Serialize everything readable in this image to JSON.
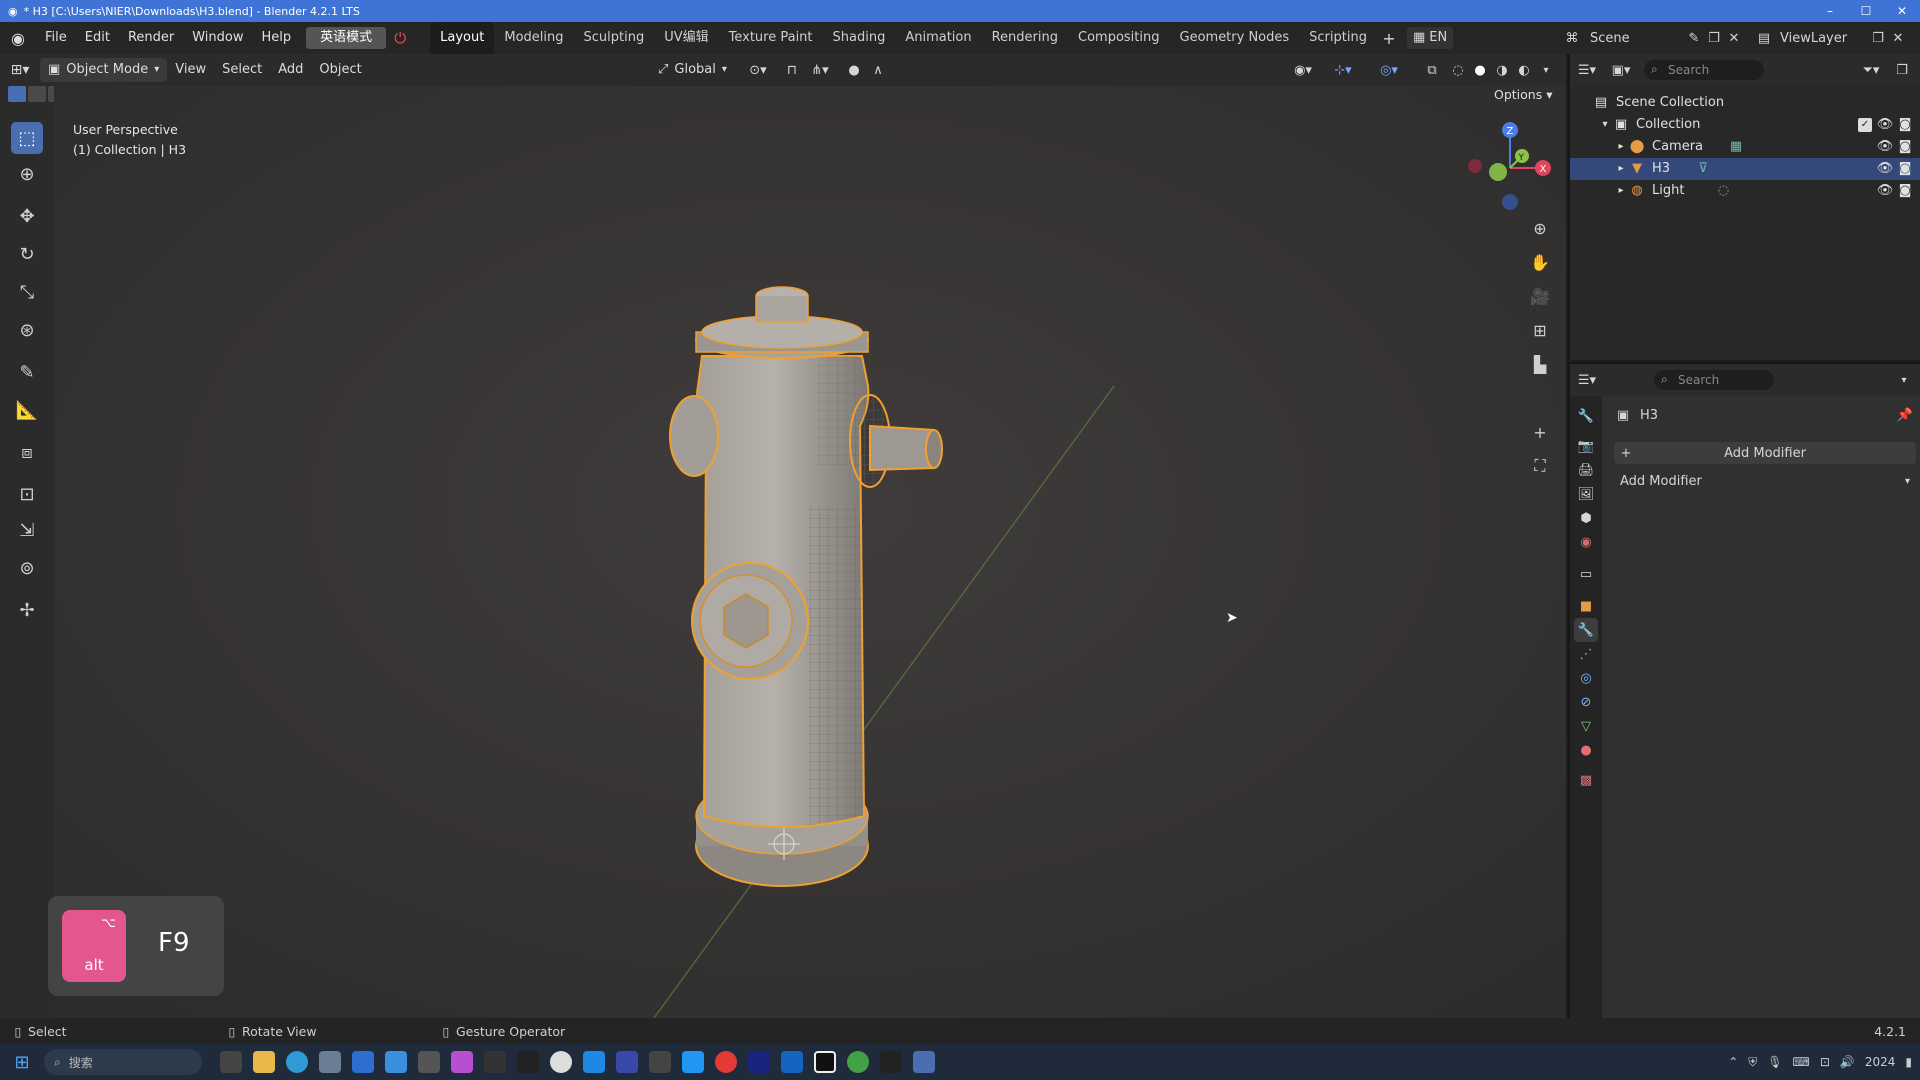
{
  "titlebar": {
    "title": "* H3 [C:\\Users\\NIER\\Downloads\\H3.blend] - Blender 4.2.1 LTS",
    "minimize": "–",
    "maximize": "☐",
    "close": "✕"
  },
  "menu": {
    "items": [
      "File",
      "Edit",
      "Render",
      "Window",
      "Help"
    ],
    "ime_label": "英语模式"
  },
  "workspaces": [
    "Layout",
    "Modeling",
    "Sculpting",
    "UV编辑",
    "Texture Paint",
    "Shading",
    "Animation",
    "Rendering",
    "Compositing",
    "Geometry Nodes",
    "Scripting"
  ],
  "active_workspace": "Layout",
  "lang": "EN",
  "scene": {
    "label": "Scene",
    "viewlayer": "ViewLayer"
  },
  "viewport_header": {
    "mode": "Object Mode",
    "menus": [
      "View",
      "Select",
      "Add",
      "Object"
    ],
    "orientation": "Global",
    "options": "Options"
  },
  "viewport_info": {
    "perspective": "User Perspective",
    "collection": "(1) Collection | H3"
  },
  "gizmo": {
    "x": "X",
    "y": "Y",
    "z": "Z"
  },
  "outliner": {
    "search_placeholder": "Search",
    "root": "Scene Collection",
    "collection": "Collection",
    "items": [
      {
        "name": "Camera",
        "selected": false
      },
      {
        "name": "H3",
        "selected": true
      },
      {
        "name": "Light",
        "selected": false
      }
    ]
  },
  "properties": {
    "search_placeholder": "Search",
    "object_name": "H3",
    "add_modifier_button": "Add Modifier",
    "add_modifier_panel": "Add Modifier"
  },
  "keys": {
    "modifier_symbol": "⌥",
    "modifier": "alt",
    "key": "F9"
  },
  "statusbar": {
    "select": "Select",
    "rotate": "Rotate View",
    "gesture": "Gesture Operator",
    "version": "4.2.1"
  },
  "taskbar": {
    "search_placeholder": "搜索",
    "clock": "2024"
  },
  "colors": {
    "accent": "#4a6fb0",
    "selection": "#f0a030",
    "titlebar": "#3f74d6",
    "keycap": "#e4578e"
  }
}
